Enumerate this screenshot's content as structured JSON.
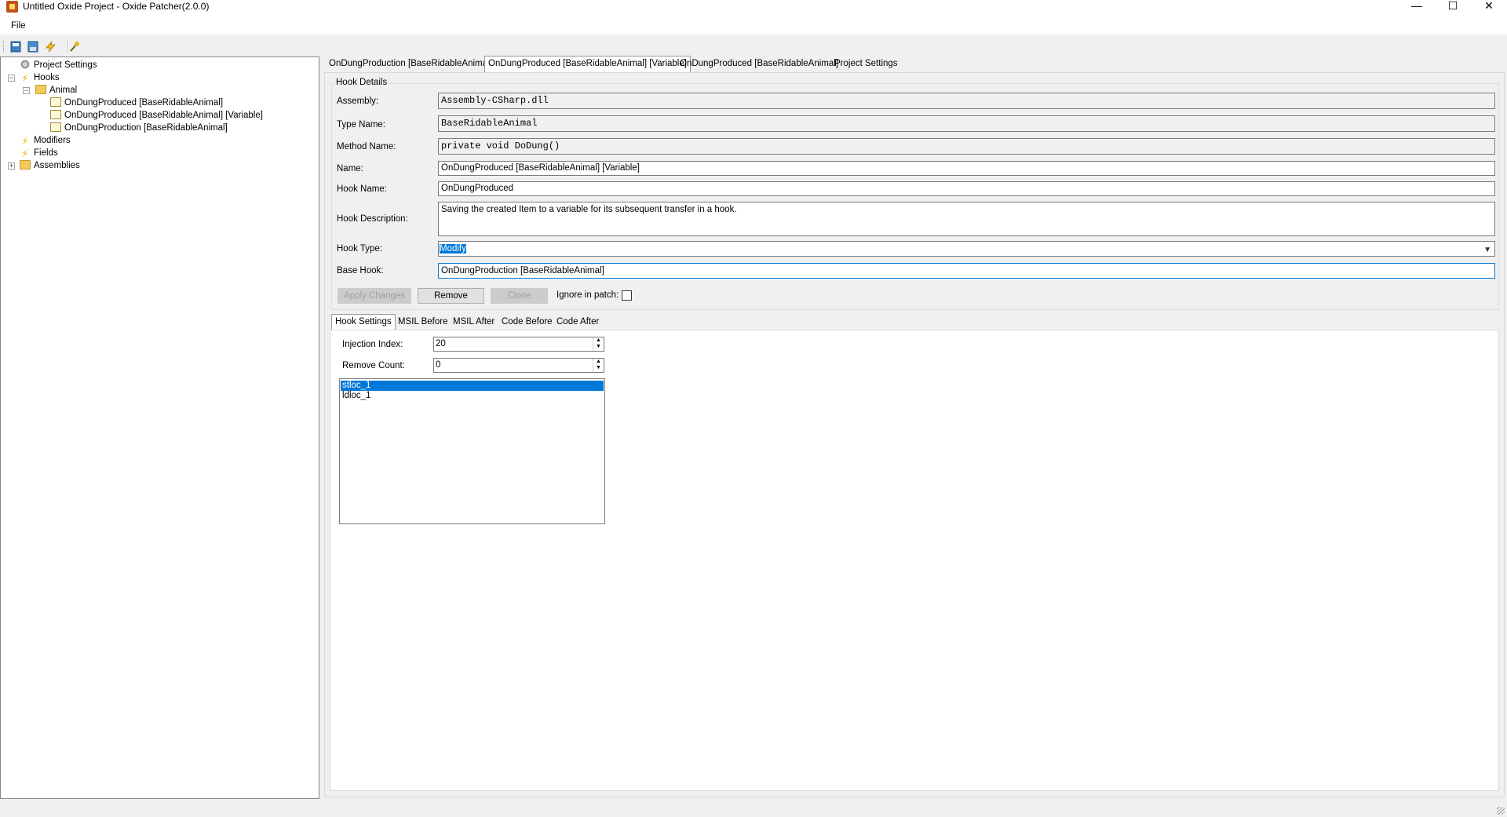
{
  "window": {
    "title": "Untitled Oxide Project - Oxide Patcher(2.0.0)",
    "minimize_glyph": "—",
    "maximize_glyph": "☐",
    "close_glyph": "✕"
  },
  "menu": {
    "file": "File"
  },
  "toolbar": {
    "icons": [
      "new-project-icon",
      "save-project-icon",
      "patch-icon",
      "settings-icon"
    ]
  },
  "tree": {
    "project_settings": "Project Settings",
    "hooks": "Hooks",
    "animal": "Animal",
    "hook_items": [
      "OnDungProduced [BaseRidableAnimal]",
      "OnDungProduced [BaseRidableAnimal] [Variable]",
      "OnDungProduction [BaseRidableAnimal]"
    ],
    "modifiers": "Modifiers",
    "fields": "Fields",
    "assemblies": "Assemblies",
    "expanded_glyph": "−",
    "collapsed_glyph": "+"
  },
  "tabs": [
    "OnDungProduction [BaseRidableAnimal]",
    "OnDungProduced [BaseRidableAnimal] [Variable]",
    "OnDungProduced [BaseRidableAnimal]",
    "Project Settings"
  ],
  "active_tab": 1,
  "hook_details": {
    "group_title": "Hook Details",
    "assembly_label": "Assembly:",
    "assembly_value": "Assembly-CSharp.dll",
    "type_name_label": "Type Name:",
    "type_name_value": "BaseRidableAnimal",
    "method_name_label": "Method Name:",
    "method_name_value": "private void DoDung()",
    "name_label": "Name:",
    "name_value": "OnDungProduced [BaseRidableAnimal] [Variable]",
    "hook_name_label": "Hook Name:",
    "hook_name_value": "OnDungProduced",
    "hook_description_label": "Hook Description:",
    "hook_description_value": "Saving the created Item to a variable for its subsequent transfer in a hook.",
    "hook_type_label": "Hook Type:",
    "hook_type_value": "Modify",
    "base_hook_label": "Base Hook:",
    "base_hook_value": "OnDungProduction [BaseRidableAnimal]",
    "apply_changes": "Apply Changes",
    "remove": "Remove",
    "clone": "Clone",
    "ignore_in_patch": "Ignore in patch:"
  },
  "subtabs": [
    "Hook Settings",
    "MSIL Before",
    "MSIL After",
    "Code Before",
    "Code After"
  ],
  "hook_settings": {
    "injection_index_label": "Injection Index:",
    "injection_index_value": "20",
    "remove_count_label": "Remove Count:",
    "remove_count_value": "0",
    "instructions": [
      "stloc_1",
      "ldloc_1"
    ]
  }
}
